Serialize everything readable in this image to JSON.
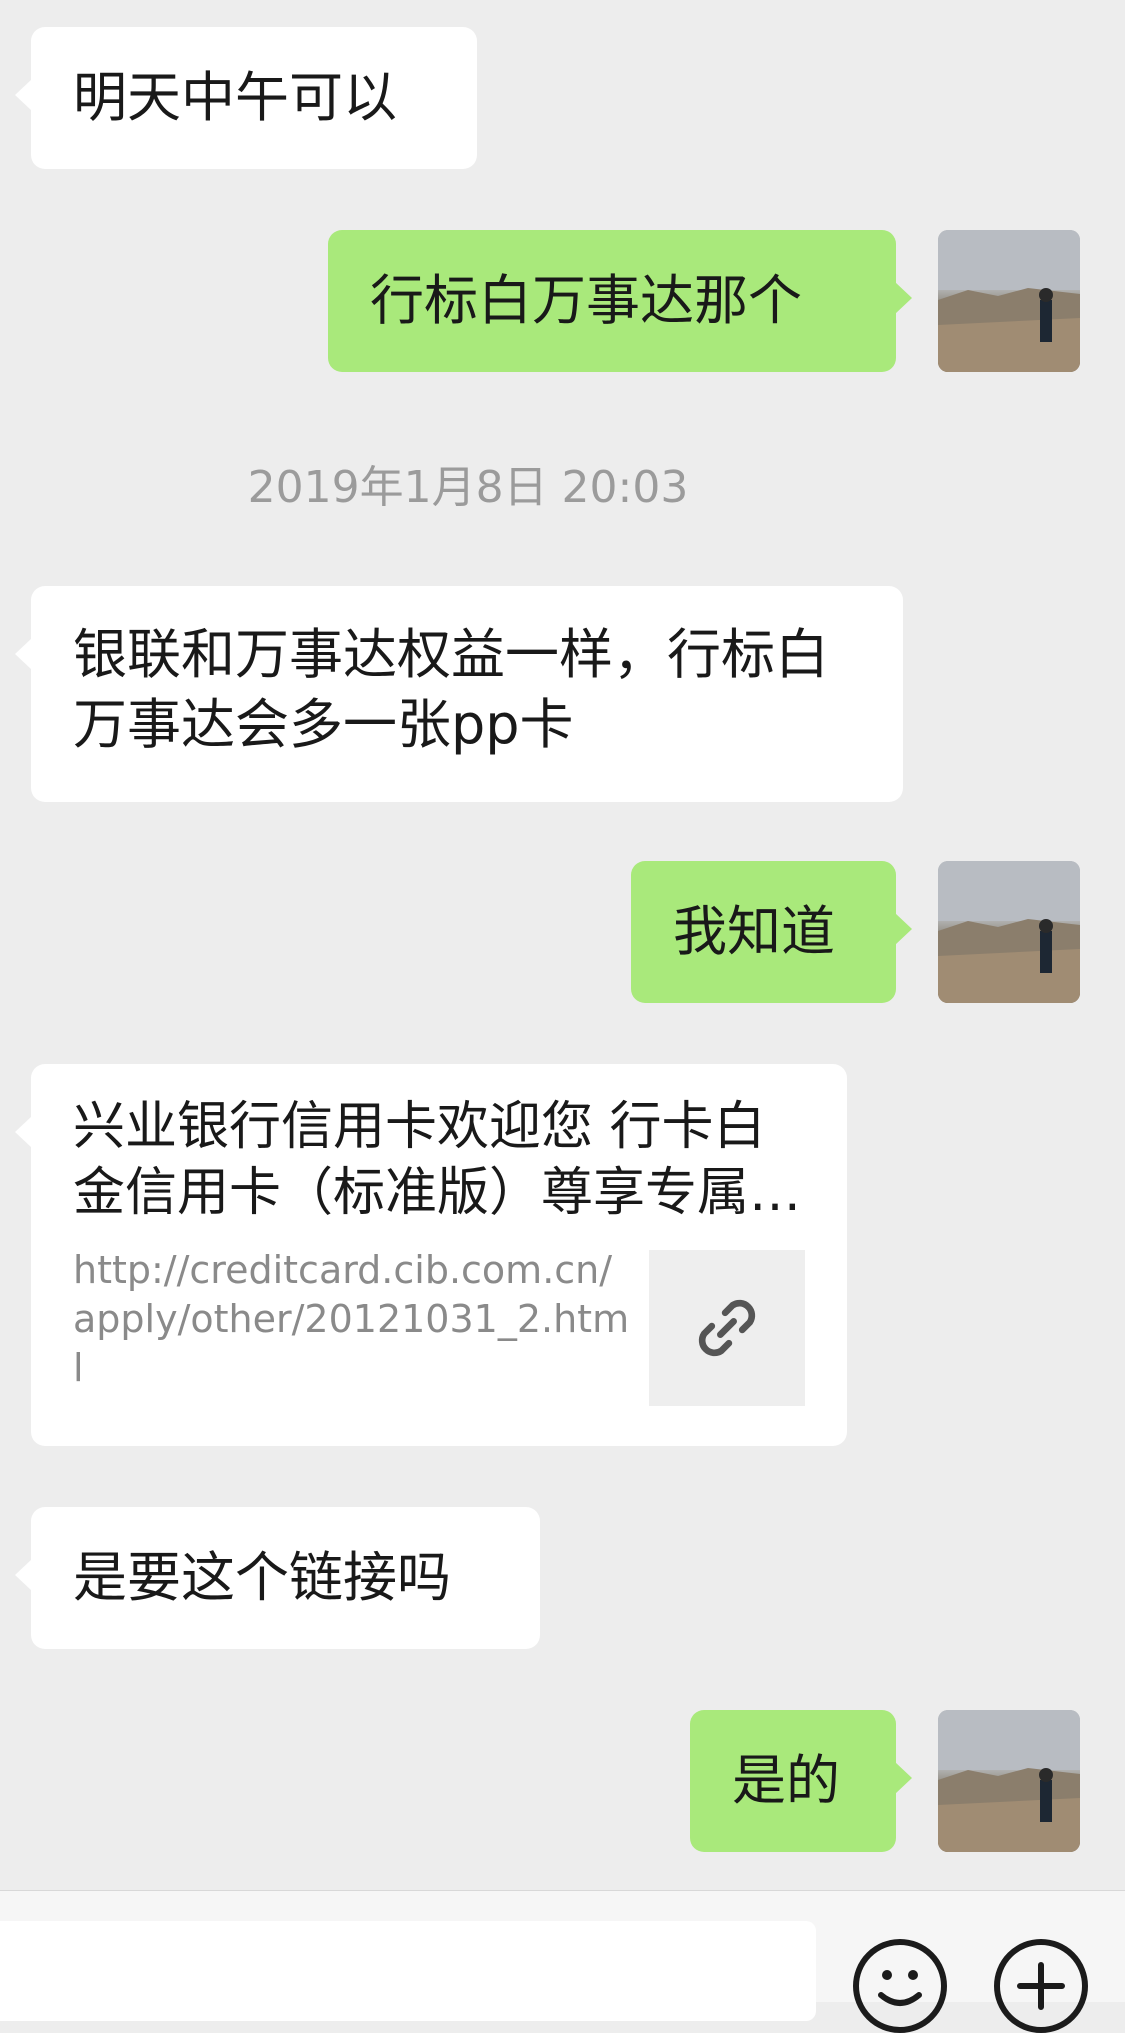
{
  "messages": [
    {
      "side": "in",
      "text": "明天中午可以"
    },
    {
      "side": "out",
      "text": "行标白万事达那个"
    },
    {
      "side": "in",
      "text": "银联和万事达权益一样，行标白万事达会多一张pp卡"
    },
    {
      "side": "out",
      "text": "我知道"
    },
    {
      "side": "in",
      "text": "是要这个链接吗"
    },
    {
      "side": "out",
      "text": "是的"
    }
  ],
  "timestamp": "2019年1月8日 20:03",
  "link_card": {
    "title": "兴业银行信用卡欢迎您 行卡白金信用卡（标准版）尊享专属权益",
    "url": "http://creditcard.cib.com.cn/apply/other/20121031_2.html",
    "thumb_icon": "link-icon"
  },
  "avatar_icon": "user-avatar-photo",
  "input_bar": {
    "emoji_icon": "emoji-icon",
    "more_icon": "plus-icon"
  }
}
